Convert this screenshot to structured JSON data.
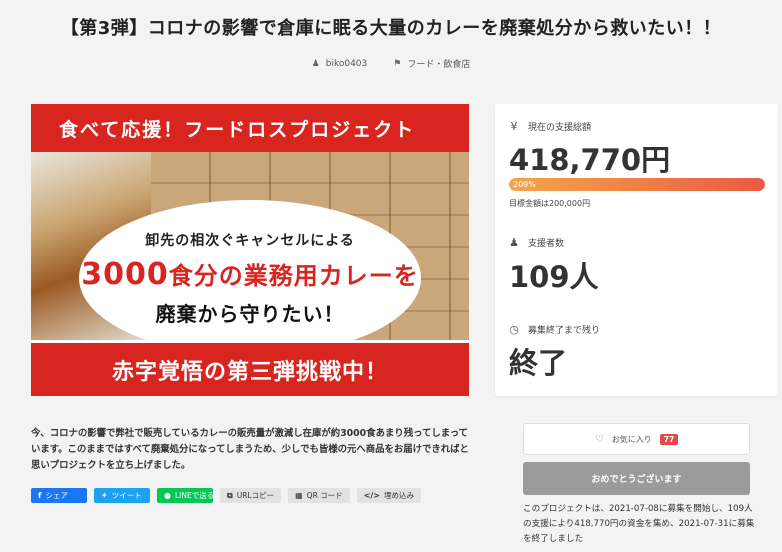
{
  "page": {
    "title": "【第3弾】コロナの影響で倉庫に眠る大量のカレーを廃棄処分から救いたい！！",
    "author": "biko0403",
    "category": "フード・飲食店"
  },
  "hero": {
    "top_text": "食べて応援！フードロスプロジェクト",
    "line1": "卸先の相次ぐキャンセルによる",
    "line2_number": "3000",
    "line2_text": "食分の業務用カレーを",
    "line3": "廃棄から守りたい！",
    "bottom_text": "赤字覚悟の第三弾挑戦中！"
  },
  "stats": {
    "total_label": "現在の支援総額",
    "total_value": "418,770円",
    "progress_label": "209%",
    "progress_fraction": 1.0,
    "goal": "目標金額は200,000円",
    "backers_label": "支援者数",
    "backers_value": "109人",
    "remaining_label": "募集終了まで残り",
    "remaining_value": "終了"
  },
  "description": "今、コロナの影響で弊社で販売しているカレーの販売量が激減し在庫が約3000食あまり残ってしまっています。このままではすべて廃棄処分になってしまうため、少しでも皆様の元へ商品をお届けできればと思いプロジェクトを立ち上げました。",
  "share": {
    "facebook": "シェア",
    "twitter": "ツイート",
    "line": "LINEで送る",
    "url_copy": "URLコピー",
    "qr": "QR コード",
    "embed": "埋め込み"
  },
  "favorite": {
    "label": "お気に入り",
    "count": "77"
  },
  "thanks_button": "おめでとうございます",
  "summary": "このプロジェクトは、2021-07-08に募集を開始し、109人の支援により418,770円の資金を集め、2021-07-31に募集を終了しました",
  "colors": {
    "hero_red": "#d8251f",
    "progress_start": "#f4a64a",
    "progress_end": "#ea5a44",
    "facebook": "#1877f2",
    "twitter": "#1da1f2",
    "line": "#06c755",
    "favorite_badge": "#e5484d"
  },
  "icons": {
    "author": "user-icon",
    "category": "tag-icon",
    "total": "yen-icon",
    "backers": "user-icon",
    "remaining": "clock-icon",
    "favorite": "heart-icon"
  }
}
